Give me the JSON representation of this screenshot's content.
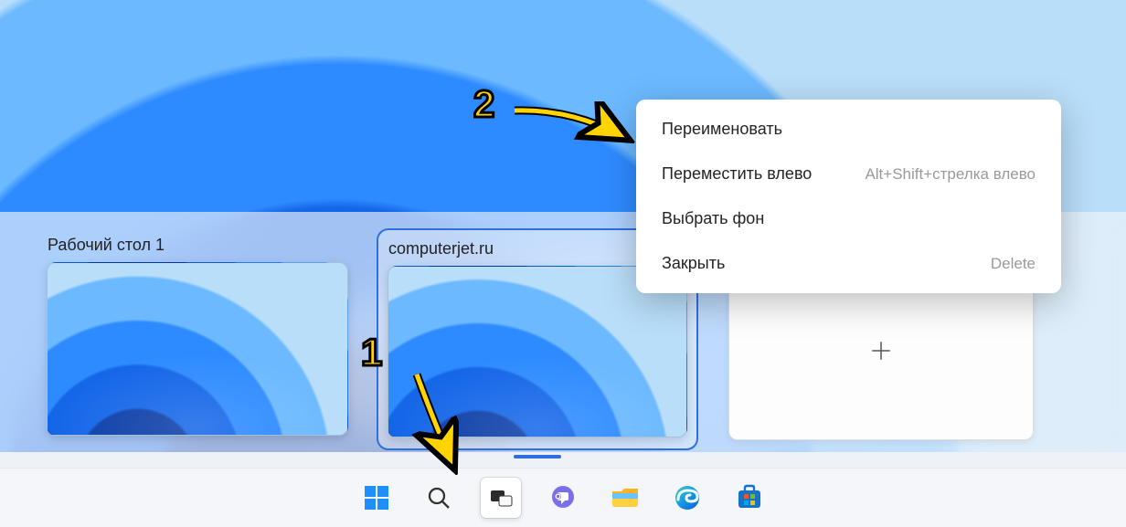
{
  "desktops": [
    {
      "label": "Рабочий стол 1"
    },
    {
      "label": "computerjet.ru"
    }
  ],
  "contextMenu": {
    "rename": "Переименовать",
    "moveLeft": "Переместить влево",
    "moveLeftShortcut": "Alt+Shift+стрелка влево",
    "background": "Выбрать фон",
    "close": "Закрыть",
    "closeShortcut": "Delete"
  },
  "annotations": {
    "one": "1",
    "two": "2"
  }
}
